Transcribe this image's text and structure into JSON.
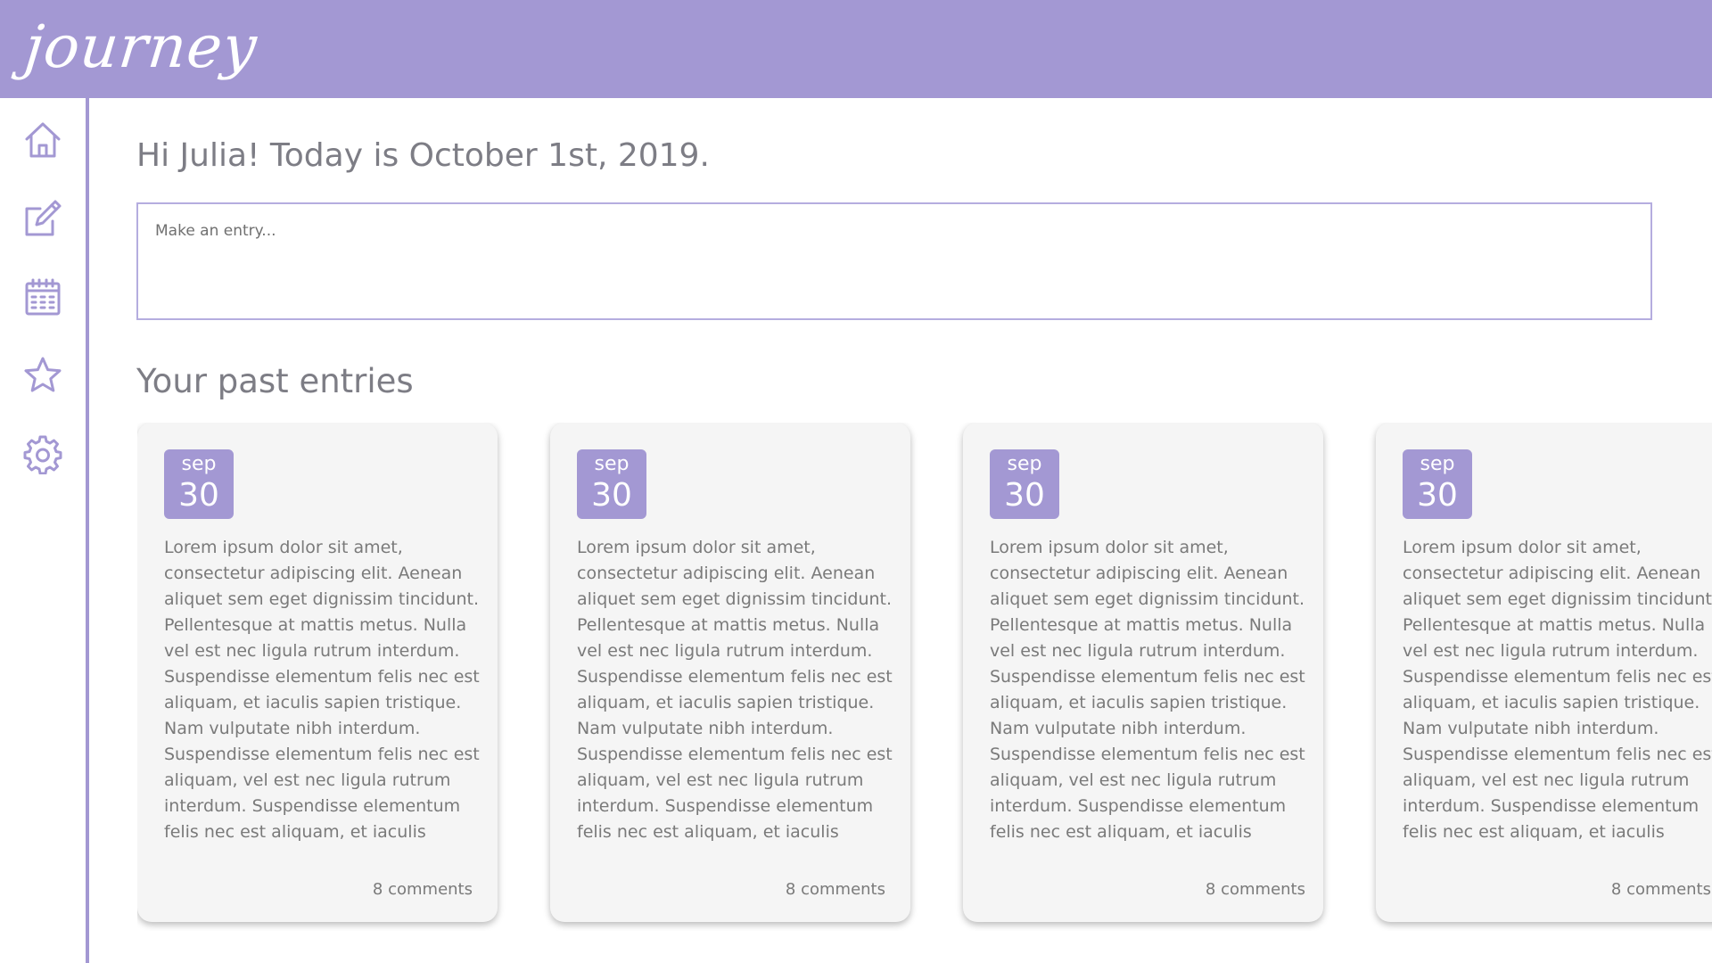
{
  "app": {
    "logo": "journey"
  },
  "colors": {
    "accent": "#a398d3",
    "text": "#7d7d85",
    "card_bg": "#f5f5f5"
  },
  "sidebar": {
    "items": [
      {
        "name": "home",
        "icon": "home-icon"
      },
      {
        "name": "write",
        "icon": "edit-icon"
      },
      {
        "name": "calendar",
        "icon": "calendar-icon"
      },
      {
        "name": "favorites",
        "icon": "star-icon"
      },
      {
        "name": "settings",
        "icon": "gear-icon"
      }
    ]
  },
  "main": {
    "greeting": "Hi Julia! Today is October 1st, 2019.",
    "entry_placeholder": "Make an entry...",
    "past_entries_title": "Your past entries"
  },
  "entries": [
    {
      "month": "sep",
      "day": "30",
      "lines": [
        "Lorem ipsum dolor sit amet,",
        "consectetur adipiscing elit. Aenean",
        "aliquet sem eget dignissim tincidunt.",
        "Pellentesque at mattis metus. Nulla",
        "vel est nec ligula rutrum interdum.",
        "Suspendisse elementum felis nec est",
        "aliquam, et iaculis sapien tristique.",
        "Nam vulputate nibh interdum.",
        "Suspendisse elementum felis nec est",
        "aliquam, vel est nec ligula rutrum",
        "interdum. Suspendisse elementum",
        "felis nec est aliquam, et iaculis"
      ],
      "comments": "8 comments"
    },
    {
      "month": "sep",
      "day": "30",
      "lines": [
        "Lorem ipsum dolor sit amet,",
        "consectetur adipiscing elit. Aenean",
        "aliquet sem eget dignissim tincidunt.",
        "Pellentesque at mattis metus. Nulla",
        "vel est nec ligula rutrum interdum.",
        "Suspendisse elementum felis nec est",
        "aliquam, et iaculis sapien tristique.",
        "Nam vulputate nibh interdum.",
        "Suspendisse elementum felis nec est",
        "aliquam, vel est nec ligula rutrum",
        "interdum. Suspendisse elementum",
        "felis nec est aliquam, et iaculis"
      ],
      "comments": "8 comments"
    },
    {
      "month": "sep",
      "day": "30",
      "lines": [
        "Lorem ipsum dolor sit amet,",
        "consectetur adipiscing elit. Aenean",
        "aliquet sem eget dignissim tincidunt.",
        "Pellentesque at mattis metus. Nulla",
        "vel est nec ligula rutrum interdum.",
        "Suspendisse elementum felis nec est",
        "aliquam, et iaculis sapien tristique.",
        "Nam vulputate nibh interdum.",
        "Suspendisse elementum felis nec est",
        "aliquam, vel est nec ligula rutrum",
        "interdum. Suspendisse elementum",
        "felis nec est aliquam, et iaculis"
      ],
      "comments": "8 comments"
    },
    {
      "month": "sep",
      "day": "30",
      "lines": [
        "Lorem ipsum dolor sit amet,",
        "consectetur adipiscing elit. Aenean",
        "aliquet sem eget dignissim tincidunt.",
        "Pellentesque at mattis metus. Nulla",
        "vel est nec ligula rutrum interdum.",
        "Suspendisse elementum felis nec est",
        "aliquam, et iaculis sapien tristique.",
        "Nam vulputate nibh interdum.",
        "Suspendisse elementum felis nec est",
        "aliquam, vel est nec ligula rutrum",
        "interdum. Suspendisse elementum",
        "felis nec est aliquam, et iaculis"
      ],
      "comments": "8 comments"
    }
  ]
}
